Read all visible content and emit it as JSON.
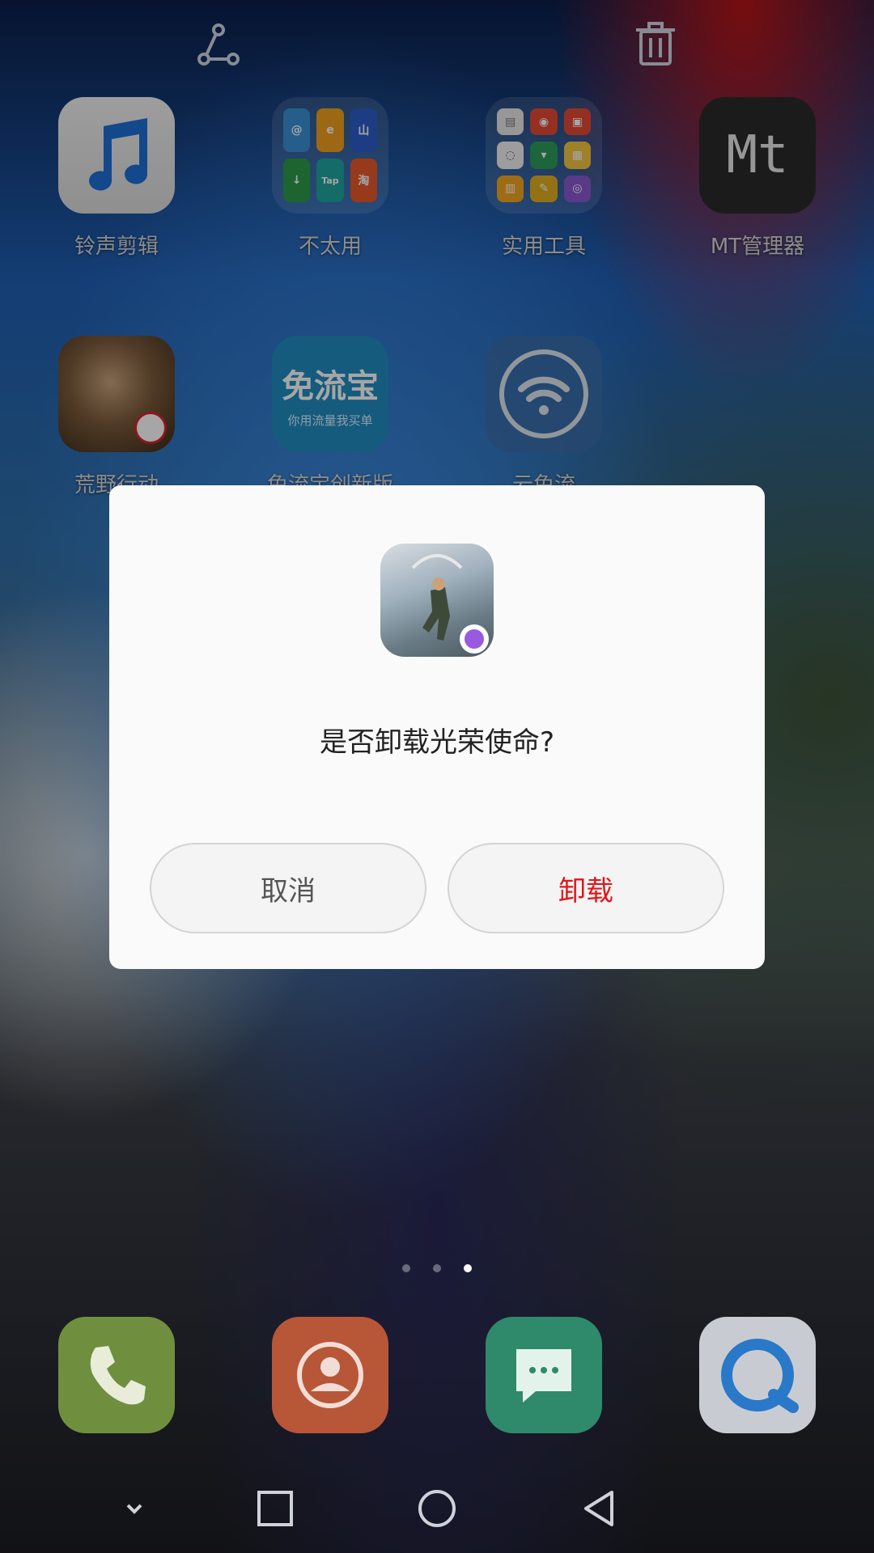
{
  "top_bar": {
    "share_icon": "share-icon",
    "delete_icon": "trash-icon"
  },
  "home_apps": [
    {
      "label": "铃声剪辑"
    },
    {
      "label": "不太用",
      "mini_icons": [
        "@",
        "e",
        "山",
        "↓",
        "Tap",
        "淘"
      ]
    },
    {
      "label": "实用工具",
      "mini_icons": [
        "▤",
        "◉",
        "▣",
        "◌",
        "▾",
        "▦",
        "▥",
        "✎",
        "◎"
      ]
    },
    {
      "label": "MT管理器",
      "icon_text": "Mt"
    },
    {
      "label": "荒野行动"
    },
    {
      "label": "免流宝创新版",
      "icon_title": "免流宝",
      "icon_sub": "你用流量我买单"
    },
    {
      "label": "云免流"
    }
  ],
  "dialog": {
    "message": "是否卸载光荣使命?",
    "cancel_label": "取消",
    "confirm_label": "卸载",
    "confirm_color": "#e0161b"
  },
  "pager": {
    "pages": 3,
    "active": 3
  },
  "dock": [
    {
      "icon": "phone-icon",
      "color": "#6f8f3f"
    },
    {
      "icon": "contacts-icon",
      "color": "#b85638"
    },
    {
      "icon": "messages-icon",
      "color": "#2e8a6a"
    },
    {
      "icon": "browser-icon",
      "color": "#c8ccd2"
    }
  ],
  "nav_bar": [
    "chevron-down-icon",
    "recents-icon",
    "home-icon",
    "back-icon"
  ]
}
